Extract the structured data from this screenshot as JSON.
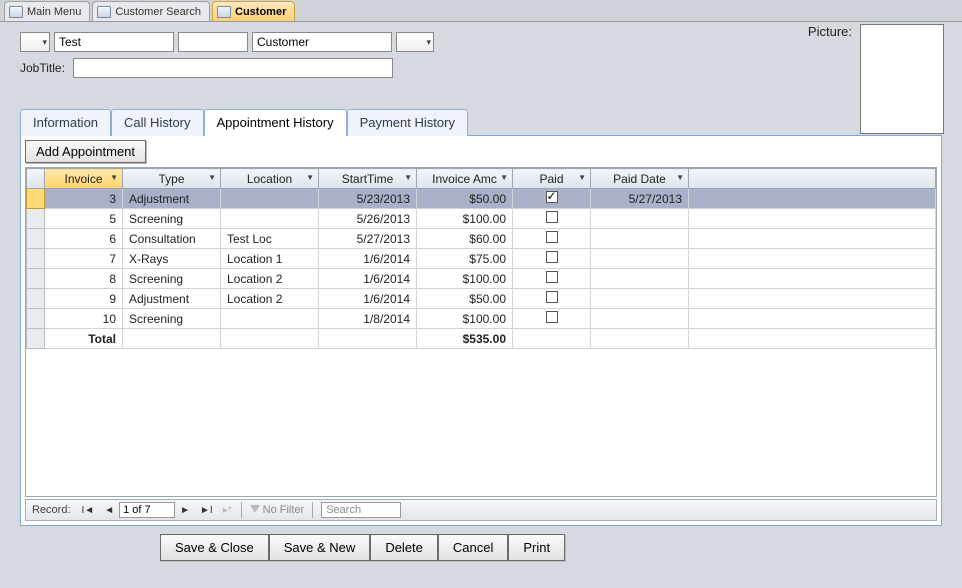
{
  "top_tabs": {
    "main_menu": "Main Menu",
    "customer_search": "Customer Search",
    "customer": "Customer"
  },
  "header": {
    "first_name": "Test",
    "middle_name": "",
    "last_name": "Customer",
    "picture_label": "Picture:",
    "jobtitle_label": "JobTitle:",
    "jobtitle_value": ""
  },
  "tabs": {
    "information": "Information",
    "call_history": "Call History",
    "appointment_history": "Appointment History",
    "payment_history": "Payment History"
  },
  "panel": {
    "add_appointment": "Add Appointment",
    "columns": {
      "invoice": "Invoice",
      "type": "Type",
      "location": "Location",
      "starttime": "StartTime",
      "invoice_amt": "Invoice Amc",
      "paid": "Paid",
      "paid_date": "Paid Date"
    },
    "rows": [
      {
        "invoice": "3",
        "type": "Adjustment",
        "location": "",
        "start": "5/23/2013",
        "amt": "$50.00",
        "paid": true,
        "paid_date": "5/27/2013"
      },
      {
        "invoice": "5",
        "type": "Screening",
        "location": "",
        "start": "5/26/2013",
        "amt": "$100.00",
        "paid": false,
        "paid_date": ""
      },
      {
        "invoice": "6",
        "type": "Consultation",
        "location": "Test Loc",
        "start": "5/27/2013",
        "amt": "$60.00",
        "paid": false,
        "paid_date": ""
      },
      {
        "invoice": "7",
        "type": "X-Rays",
        "location": "Location 1",
        "start": "1/6/2014",
        "amt": "$75.00",
        "paid": false,
        "paid_date": ""
      },
      {
        "invoice": "8",
        "type": "Screening",
        "location": "Location 2",
        "start": "1/6/2014",
        "amt": "$100.00",
        "paid": false,
        "paid_date": ""
      },
      {
        "invoice": "9",
        "type": "Adjustment",
        "location": "Location 2",
        "start": "1/6/2014",
        "amt": "$50.00",
        "paid": false,
        "paid_date": ""
      },
      {
        "invoice": "10",
        "type": "Screening",
        "location": "",
        "start": "1/8/2014",
        "amt": "$100.00",
        "paid": false,
        "paid_date": ""
      }
    ],
    "total_label": "Total",
    "total_amount": "$535.00",
    "recnav": {
      "label": "Record:",
      "pos": "1 of 7",
      "no_filter": "No Filter",
      "search_placeholder": "Search"
    }
  },
  "bottom_buttons": {
    "save_close": "Save & Close",
    "save_new": "Save & New",
    "delete": "Delete",
    "cancel": "Cancel",
    "print": "Print"
  }
}
